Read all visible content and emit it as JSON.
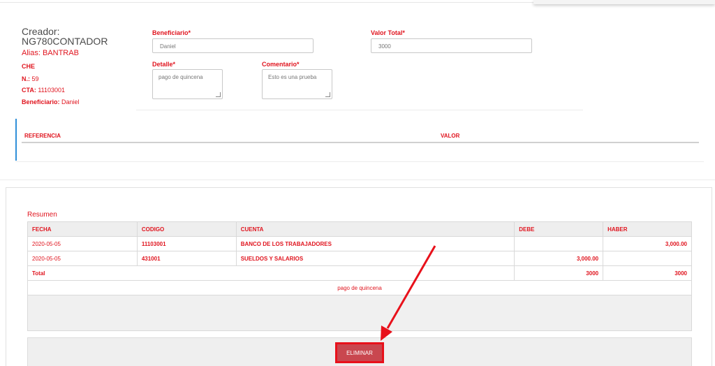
{
  "creator": {
    "label": "Creador:",
    "user": "NG780CONTADOR",
    "alias": "Alias: BANTRAB",
    "type": "CHE",
    "number_label": "N.:",
    "number_value": "59",
    "cta_label": "CTA:",
    "cta_value": "11103001",
    "beneficiary_label": "Beneficiario:",
    "beneficiary_value": "Daniel"
  },
  "form": {
    "beneficiario_label": "Beneficiario*",
    "beneficiario_value": "Daniel",
    "valor_total_label": "Valor Total*",
    "valor_total_value": "3000",
    "detalle_label": "Detalle*",
    "detalle_value": "pago de quincena",
    "comentario_label": "Comentario*",
    "comentario_value": "Esto es una prueba"
  },
  "reference_table": {
    "headers": [
      "REFERENCIA",
      "VALOR"
    ]
  },
  "summary": {
    "title": "Resumen",
    "headers": [
      "FECHA",
      "CODIGO",
      "CUENTA",
      "DEBE",
      "HABER"
    ],
    "rows": [
      [
        "2020-05-05",
        "11103001",
        "BANCO DE LOS TRABAJADORES",
        "",
        "3,000.00"
      ],
      [
        "2020-05-05",
        "431001",
        "SUELDOS Y SALARIOS",
        "3,000.00",
        ""
      ]
    ],
    "total_label": "Total",
    "total_debe": "3000",
    "total_haber": "3000",
    "note": "pago de quincena"
  },
  "actions": {
    "delete_label": "ELIMINAR"
  },
  "colors": {
    "accent": "#e0141e",
    "button_bg": "#c9474f",
    "highlight": "#e8111b",
    "blue_marker": "#2f8fd8"
  }
}
